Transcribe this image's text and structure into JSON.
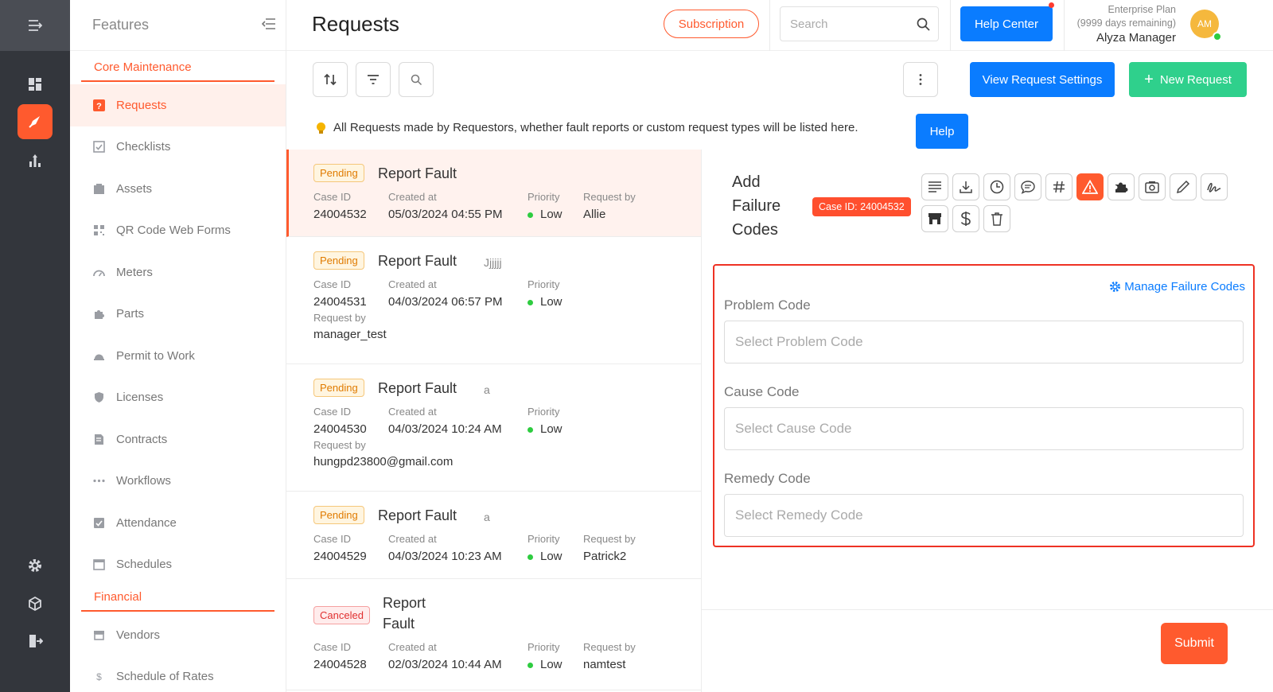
{
  "rail": {
    "icons": [
      "menu-expand-icon",
      "dashboard-icon",
      "requests-rocket-icon",
      "analytics-icon",
      "settings-icon",
      "package-icon",
      "logout-icon"
    ]
  },
  "sidebar": {
    "title": "Features",
    "sections": [
      {
        "label": "Core Maintenance",
        "items": [
          {
            "label": "Requests",
            "icon": "request-icon",
            "active": true
          },
          {
            "label": "Checklists",
            "icon": "checklist-icon"
          },
          {
            "label": "Assets",
            "icon": "assets-icon"
          },
          {
            "label": "QR Code Web Forms",
            "icon": "qr-code-icon"
          },
          {
            "label": "Meters",
            "icon": "meter-icon"
          },
          {
            "label": "Parts",
            "icon": "parts-icon"
          },
          {
            "label": "Permit to Work",
            "icon": "permit-icon"
          },
          {
            "label": "Licenses",
            "icon": "license-icon"
          },
          {
            "label": "Contracts",
            "icon": "contract-icon"
          },
          {
            "label": "Workflows",
            "icon": "workflow-icon"
          },
          {
            "label": "Attendance",
            "icon": "attendance-icon"
          },
          {
            "label": "Schedules",
            "icon": "calendar-icon"
          }
        ]
      },
      {
        "label": "Financial",
        "items": [
          {
            "label": "Vendors",
            "icon": "vendor-icon"
          },
          {
            "label": "Schedule of Rates",
            "icon": "rates-icon"
          }
        ]
      }
    ]
  },
  "header": {
    "title": "Requests",
    "subscription_label": "Subscription",
    "search_placeholder": "Search",
    "help_center_label": "Help Center",
    "plan_name": "Enterprise Plan",
    "plan_remaining": "(9999 days remaining)",
    "user_name": "Alyza Manager",
    "avatar_initials": "AM"
  },
  "toolbar": {
    "view_settings_label": "View Request Settings",
    "new_request_label": "New Request"
  },
  "info": {
    "text": "All Requests made by Requestors, whether fault reports or custom request types will be listed here.",
    "help_label": "Help"
  },
  "labels": {
    "case_id": "Case ID",
    "created_at": "Created at",
    "priority": "Priority",
    "request_by": "Request by"
  },
  "requests": [
    {
      "status": "Pending",
      "title": "Report Fault",
      "extra": "",
      "case_id": "24004532",
      "created": "05/03/2024 04:55 PM",
      "priority": "Low",
      "by": "Allie"
    },
    {
      "status": "Pending",
      "title": "Report Fault",
      "extra": "Jjjjjj",
      "case_id": "24004531",
      "created": "04/03/2024 06:57 PM",
      "priority": "Low",
      "by": "manager_test"
    },
    {
      "status": "Pending",
      "title": "Report Fault",
      "extra": "a",
      "case_id": "24004530",
      "created": "04/03/2024 10:24 AM",
      "priority": "Low",
      "by": "hungpd23800@gmail.com"
    },
    {
      "status": "Pending",
      "title": "Report Fault",
      "extra": "a",
      "case_id": "24004529",
      "created": "04/03/2024 10:23 AM",
      "priority": "Low",
      "by": "Patrick2"
    },
    {
      "status": "Canceled",
      "title_line1": "Report",
      "title_line2": "Fault",
      "case_id": "24004528",
      "created": "02/03/2024 10:44 AM",
      "priority": "Low",
      "by": "namtest"
    }
  ],
  "detail": {
    "title_line1": "Add",
    "title_line2": "Failure",
    "title_line3": "Codes",
    "case_badge": "Case ID: 24004532",
    "actions": [
      "description-icon",
      "download-icon",
      "clock-icon",
      "comment-icon",
      "hash-icon",
      "warning-icon",
      "puzzle-icon",
      "camera-icon",
      "edit-icon",
      "signature-icon",
      "store-icon",
      "dollar-icon",
      "trash-icon"
    ],
    "manage_link": "Manage Failure Codes",
    "problem_label": "Problem Code",
    "problem_placeholder": "Select Problem Code",
    "cause_label": "Cause Code",
    "cause_placeholder": "Select Cause Code",
    "remedy_label": "Remedy Code",
    "remedy_placeholder": "Select Remedy Code",
    "submit_label": "Submit"
  },
  "colors": {
    "accent": "#ff5a2e",
    "primary": "#0a7cff",
    "success": "#2fd08c",
    "highlight_border": "#ee3224"
  }
}
